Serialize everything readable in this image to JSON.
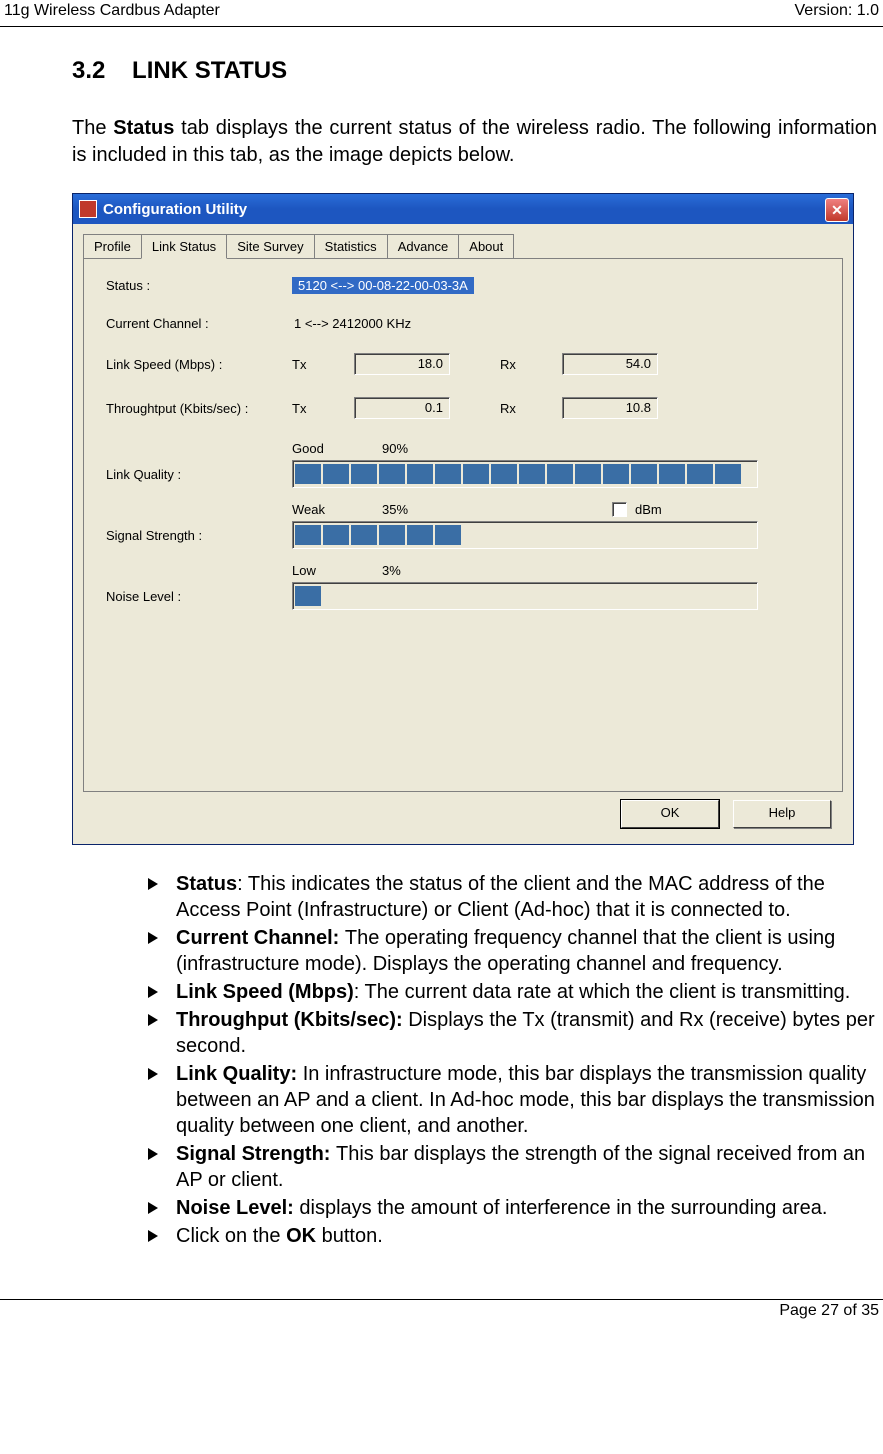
{
  "header": {
    "left": "11g Wireless Cardbus Adapter",
    "right": "Version: 1.0"
  },
  "section": {
    "number": "3.2",
    "title": "LINK STATUS"
  },
  "intro": {
    "p1a": "The ",
    "p1b": "Status",
    "p1c": " tab displays the current status of the wireless radio.  The following information is included in this tab, as the image depicts below."
  },
  "dialog": {
    "title": "Configuration Utility",
    "tabs": [
      "Profile",
      "Link Status",
      "Site Survey",
      "Statistics",
      "Advance",
      "About"
    ],
    "activeTab": 1,
    "labels": {
      "status": "Status :",
      "channel": "Current Channel :",
      "linkspeed": "Link Speed (Mbps) :",
      "throughput": "Throughtput (Kbits/sec) :",
      "linkquality": "Link Quality :",
      "signal": "Signal Strength :",
      "noise": "Noise Level :",
      "tx": "Tx",
      "rx": "Rx",
      "good": "Good",
      "weak": "Weak",
      "low": "Low",
      "dbm": "dBm"
    },
    "values": {
      "status": "5120 <--> 00-08-22-00-03-3A",
      "channel": "1 <--> 2412000 KHz",
      "ls_tx": "18.0",
      "ls_rx": "54.0",
      "tp_tx": "0.1",
      "tp_rx": "10.8",
      "lq_pct": "90%",
      "ss_pct": "35%",
      "nl_pct": "3%"
    },
    "bars": {
      "linkQualitySegments": 16,
      "linkQualityFilled": 16,
      "signalSegments": 16,
      "signalFilled": 6,
      "noiseSegments": 16,
      "noiseFilled": 1
    },
    "buttons": {
      "ok": "OK",
      "help": "Help"
    }
  },
  "bullets": {
    "b1a": "Status",
    "b1b": ": This indicates the status of the client and the MAC address of the Access Point (Infrastructure) or Client (Ad-hoc) that it is connected to.",
    "b2a": "Current Channel: ",
    "b2b": "The operating frequency channel that the client is using (infrastructure mode). Displays the operating channel and frequency.",
    "b3a": "Link Speed (Mbps)",
    "b3b": ": The current data rate at which the client is transmitting.",
    "b4a": "Throughput (Kbits/sec): ",
    "b4b": "Displays the Tx (transmit) and Rx (receive) bytes per second.",
    "b5a": "Link Quality: ",
    "b5b": "In infrastructure mode, this bar displays the transmission quality between an AP and a client. In Ad-hoc mode, this bar displays the transmission quality between one client, and another.",
    "b6a": "Signal Strength: ",
    "b6b": "This bar displays the strength of the signal received from an AP or client.",
    "b7a": "Noise Level: ",
    "b7b": "displays the amount of interference in the surrounding area.",
    "b8a": "Click on the ",
    "b8b": "OK",
    "b8c": " button."
  },
  "footer": "Page 27 of 35"
}
